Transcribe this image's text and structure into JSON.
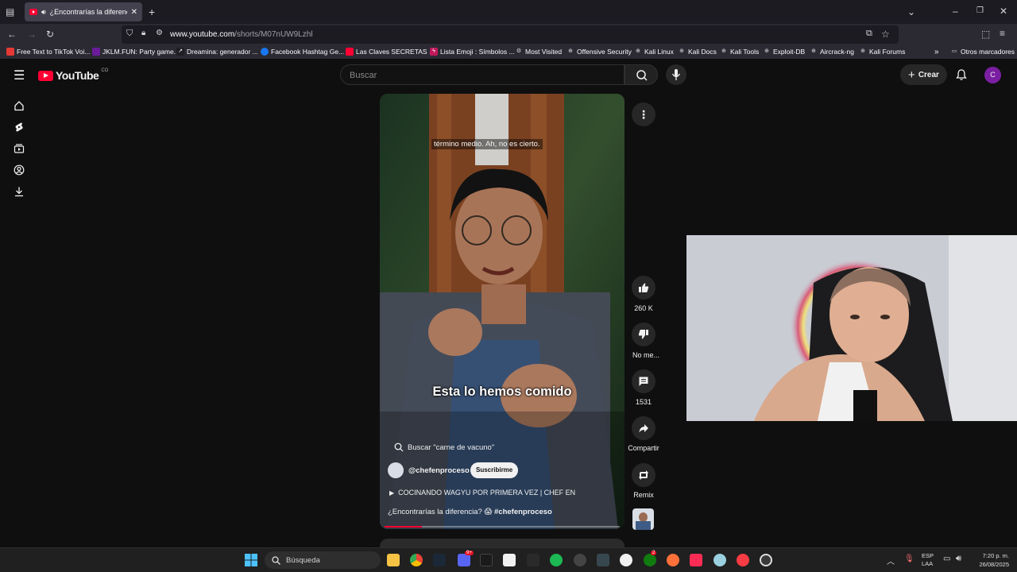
{
  "browser": {
    "tab_title": "¿Encontrarías la diferencia?",
    "url_host": "www.youtube.com",
    "url_path": "/shorts/M07nUW9Lzhl",
    "bookmarks": [
      "Free Text to TikTok Voi...",
      "JKLM.FUN: Party game...",
      "Dreamina: generador ...",
      "Facebook Hashtag Ge...",
      "Las Claves SECRETAS ...",
      "Lista Emoji : Símbolos ...",
      "Most Visited",
      "Offensive Security",
      "Kali Linux",
      "Kali Docs",
      "Kali Tools",
      "Exploit-DB",
      "Aircrack-ng",
      "Kali Forums"
    ],
    "other_bookmarks": "Otros marcadores"
  },
  "youtube": {
    "logo": "YouTube",
    "region": "CO",
    "search_placeholder": "Buscar",
    "create_label": "Crear",
    "avatar_letter": "C",
    "short": {
      "caption_top": "término medio. Ah, no es cierto.",
      "caption_main": "Esta lo hemos comido",
      "search_suggestion": "Buscar \"carne de vacuno\"",
      "channel": "@chefenproceso",
      "subscribe": "Suscribirme",
      "playlist": "COCINANDO WAGYU POR PRIMERA VEZ | CHEF EN",
      "description": "¿Encontrarías la diferencia? 😱",
      "hashtag": "#chefenproceso",
      "progress": 0.16
    },
    "actions": {
      "likes": "260 K",
      "dislike": "No me...",
      "comments": "1531",
      "share": "Compartir",
      "remix": "Remix"
    }
  },
  "taskbar": {
    "search": "Búsqueda",
    "lang1": "ESP",
    "lang2": "LAA",
    "time": "7:20 p. m.",
    "date": "26/08/2025",
    "discord_badge": "9+",
    "xbox_badge": "2"
  }
}
